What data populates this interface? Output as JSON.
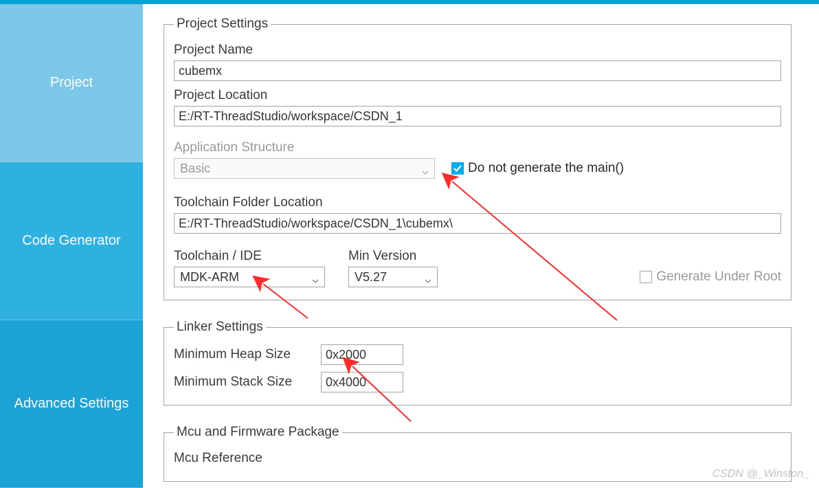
{
  "sidebar": {
    "project": "Project",
    "codegen": "Code Generator",
    "advanced": "Advanced Settings"
  },
  "project_settings": {
    "legend": "Project Settings",
    "name_label": "Project Name",
    "name_value": "cubemx",
    "location_label": "Project Location",
    "location_value": "E:/RT-ThreadStudio/workspace/CSDN_1",
    "app_structure_label": "Application Structure",
    "app_structure_value": "Basic",
    "no_main_label": "Do not generate the main()",
    "toolchain_folder_label": "Toolchain Folder Location",
    "toolchain_folder_value": "E:/RT-ThreadStudio/workspace/CSDN_1\\cubemx\\",
    "toolchain_label": "Toolchain / IDE",
    "toolchain_value": "MDK-ARM",
    "min_version_label": "Min Version",
    "min_version_value": "V5.27",
    "gen_under_root_label": "Generate Under Root"
  },
  "linker": {
    "legend": "Linker Settings",
    "heap_label": "Minimum Heap Size",
    "heap_value": "0x2000",
    "stack_label": "Minimum Stack Size",
    "stack_value": "0x4000"
  },
  "mcu": {
    "legend": "Mcu and Firmware Package",
    "ref_label": "Mcu Reference"
  },
  "watermark": "CSDN @_Winston_"
}
